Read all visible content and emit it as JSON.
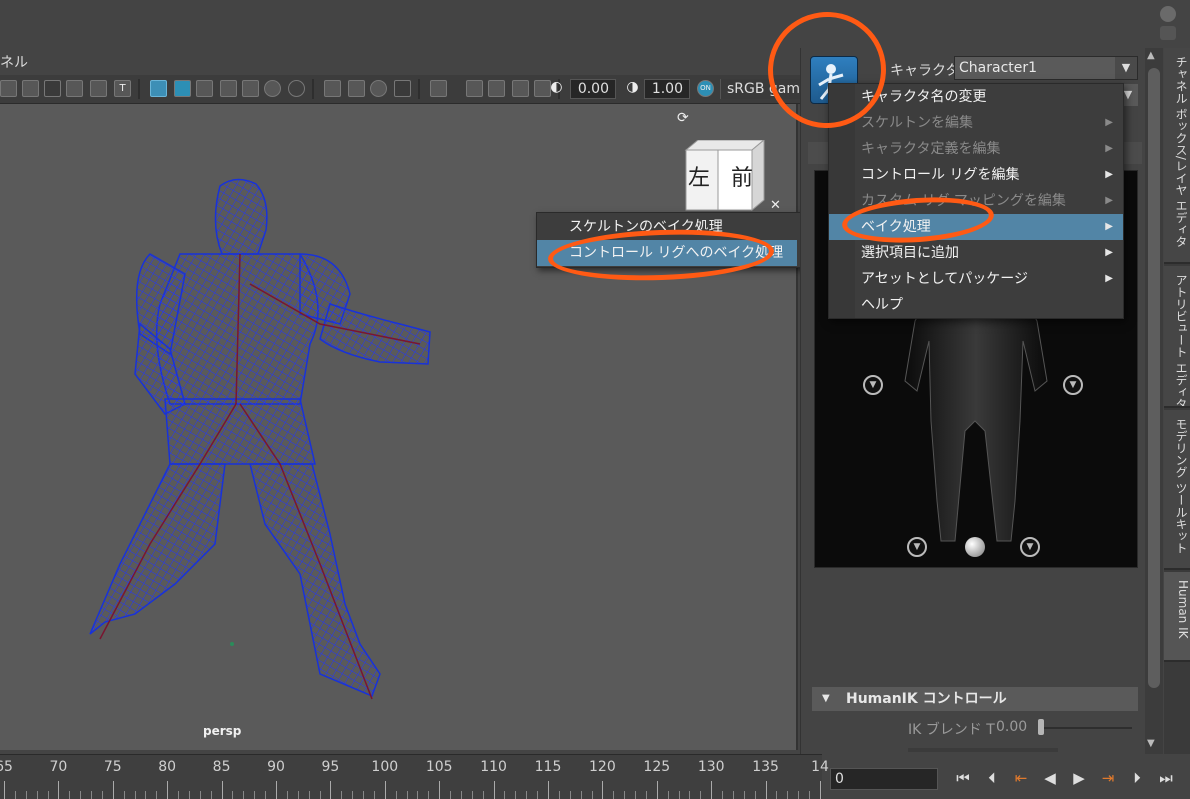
{
  "viewport": {
    "panel_title": "ネル",
    "near_value": "0.00",
    "far_value": "1.00",
    "color_space": "sRGB gam",
    "camera_label": "persp",
    "view_cube": {
      "left_face": "左",
      "front_face": "前"
    }
  },
  "bake_submenu": {
    "items": [
      {
        "label": "スケルトンのベイク処理",
        "highlighted": false
      },
      {
        "label": "コントロール リグへのベイク処理",
        "highlighted": true
      }
    ]
  },
  "character_panel": {
    "character_label": "キャラクタ:",
    "character_value": "Character1"
  },
  "context_menu": {
    "items": [
      {
        "label": "キャラクタ名の変更",
        "submenu": false,
        "disabled": false,
        "highlighted": false
      },
      {
        "label": "スケルトンを編集",
        "submenu": true,
        "disabled": true,
        "highlighted": false
      },
      {
        "label": "キャラクタ定義を編集",
        "submenu": true,
        "disabled": true,
        "highlighted": false
      },
      {
        "label": "コントロール リグを編集",
        "submenu": true,
        "disabled": false,
        "highlighted": false
      },
      {
        "label": "カスタム リグ マッピングを編集",
        "submenu": true,
        "disabled": true,
        "highlighted": false
      },
      {
        "label": "ベイク処理",
        "submenu": true,
        "disabled": false,
        "highlighted": true
      },
      {
        "label": "選択項目に追加",
        "submenu": true,
        "disabled": false,
        "highlighted": false
      },
      {
        "label": "アセットとしてパッケージ",
        "submenu": true,
        "disabled": false,
        "highlighted": false
      },
      {
        "label": "ヘルプ",
        "submenu": false,
        "disabled": false,
        "highlighted": false
      }
    ]
  },
  "humanik_controls": {
    "title": "HumanIK コントロール",
    "ik_blend_t_label": "IK ブレンド T",
    "ik_blend_t_value": "0.00",
    "ik_blend_t_level": 0.0
  },
  "side_tabs": [
    {
      "label": "チャネル ボックス/レイヤ エディタ",
      "active": false
    },
    {
      "label": "アトリビュート エディタ",
      "active": false
    },
    {
      "label": "モデリング ツールキット",
      "active": false
    },
    {
      "label": "Human IK",
      "active": true
    }
  ],
  "timeline": {
    "ticks": [
      "65",
      "70",
      "75",
      "80",
      "85",
      "90",
      "95",
      "100",
      "105",
      "110",
      "115",
      "120",
      "125",
      "130",
      "135",
      "14"
    ],
    "current_frame": "0"
  },
  "playback": {
    "buttons": [
      "go-to-start",
      "step-back-frame",
      "step-back-key",
      "play-backwards",
      "play-forwards",
      "step-forward-key",
      "step-forward-frame",
      "go-to-end"
    ],
    "glyphs": [
      "⏮",
      "⏴",
      "⇤",
      "◀",
      "▶",
      "⇥",
      "⏵",
      "⏭"
    ]
  },
  "colors": {
    "highlight": "#5285a6",
    "annotation": "#ff5a14",
    "wireframe": "#1a2fd0"
  }
}
